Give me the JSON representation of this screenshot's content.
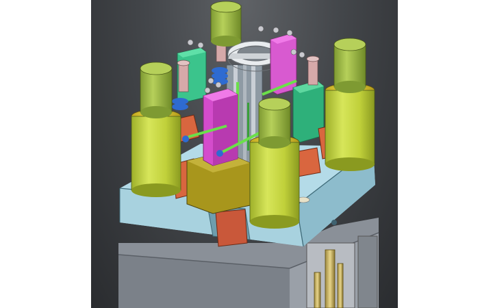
{
  "scene": {
    "subject": "cad-3d-mold-assembly-render",
    "colors": {
      "background_top": "#5f6266",
      "background_bottom": "#2a2c2f",
      "base_plate": "#a9d3e0",
      "base_plate_shadow": "#7fb0c0",
      "lower_block": "#8d939a",
      "cylinder_body": "#c8d83a",
      "cylinder_cap": "#a6c24a",
      "ring_gold": "#e8d33a",
      "magenta_block": "#e060d8",
      "green_block": "#3bc48c",
      "orange_block": "#d9663f",
      "olive_block": "#a89a1e",
      "bolt_silver": "#c9c9cf",
      "bolt_rose": "#d6a9a9",
      "blue_spring": "#2e6bd1",
      "green_rod": "#6be04a"
    }
  }
}
